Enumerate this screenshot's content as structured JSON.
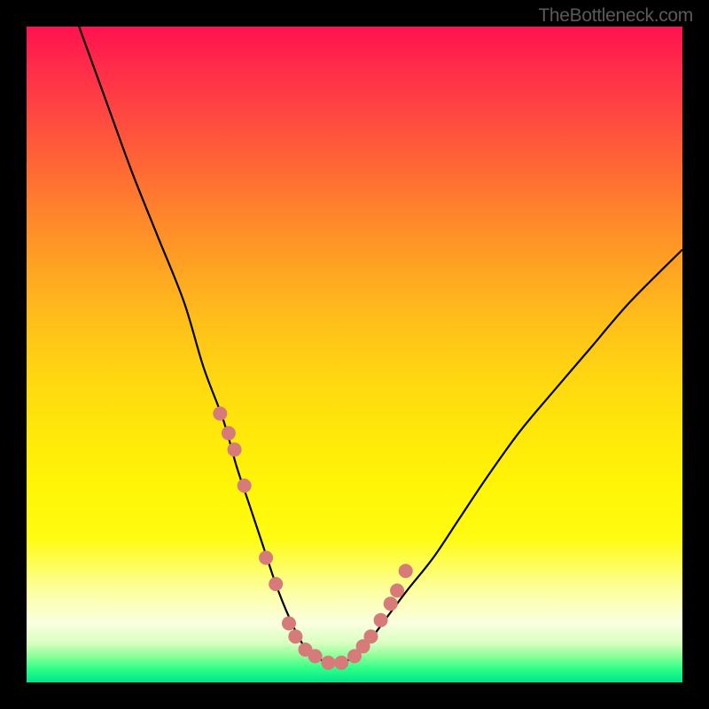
{
  "watermark": "TheBottleneck.com",
  "chart_data": {
    "type": "line",
    "title": "",
    "xlabel": "",
    "ylabel": "",
    "xlim": [
      0,
      100
    ],
    "ylim": [
      0,
      100
    ],
    "curve": {
      "x": [
        8,
        12,
        16,
        20,
        24,
        27,
        30,
        32,
        34,
        36,
        38,
        40,
        42,
        44,
        46,
        48,
        50,
        52,
        55,
        58,
        62,
        66,
        70,
        75,
        80,
        86,
        92,
        100
      ],
      "y": [
        100,
        89,
        78,
        68,
        58,
        48,
        40,
        33,
        27,
        21,
        15,
        10,
        6,
        4,
        3,
        3,
        4,
        6,
        10,
        14,
        19,
        25,
        31,
        38,
        44,
        51,
        58,
        66
      ]
    },
    "markers": {
      "x": [
        29.5,
        30.8,
        31.7,
        33.2,
        36.5,
        38.0,
        40.0,
        41.0,
        42.5,
        44.0,
        46.0,
        48.0,
        50.0,
        51.3,
        52.5,
        54.0,
        55.5,
        56.5,
        57.8
      ],
      "y": [
        41,
        38,
        35.5,
        30,
        19,
        15,
        9,
        7,
        5,
        4,
        3,
        3,
        4,
        5.5,
        7,
        9.5,
        12,
        14,
        17
      ],
      "color": "#d67a7a",
      "radius": 8
    },
    "gradient_bg": [
      {
        "stop": 0.0,
        "color": "#ff1250"
      },
      {
        "stop": 0.5,
        "color": "#ffd810"
      },
      {
        "stop": 0.95,
        "color": "#faffe0"
      },
      {
        "stop": 1.0,
        "color": "#00e58c"
      }
    ]
  }
}
